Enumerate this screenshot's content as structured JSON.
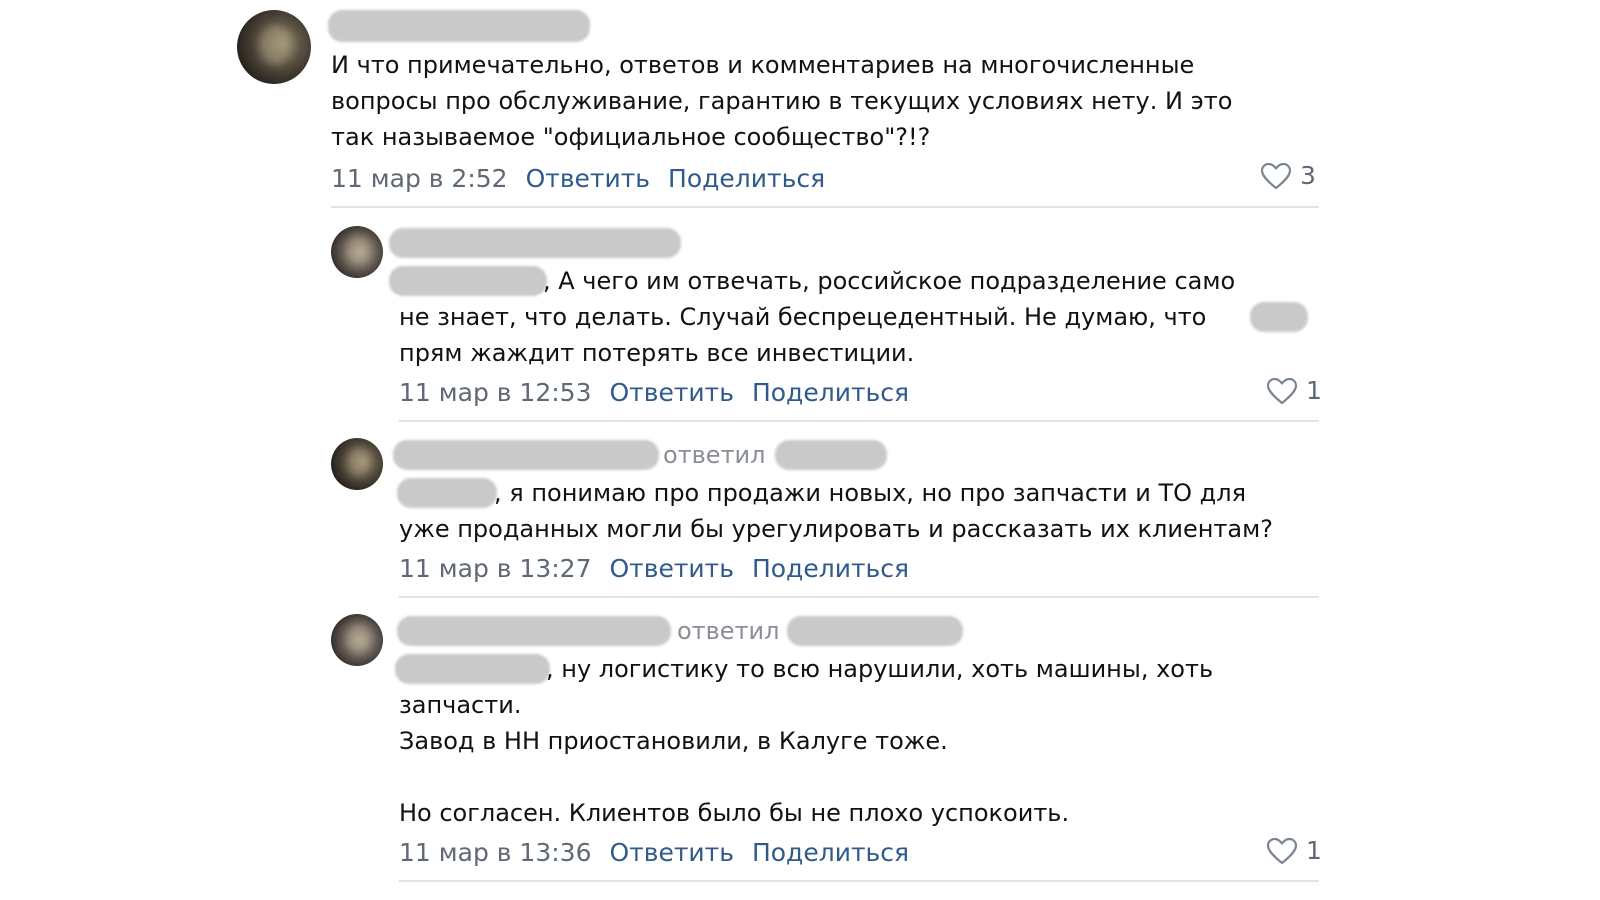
{
  "comments": [
    {
      "text_lines": [
        "И что примечательно, ответов и комментариев на многочисленные",
        "вопросы про обслуживание, гарантию в текущих условиях нету. И это",
        "так называемое \"официальное сообщество\"?!?"
      ],
      "time": "11 мар в 2:52",
      "reply_label": "Ответить",
      "share_label": "Поделиться",
      "likes": "3"
    },
    {
      "text_lines": [
        ", А чего им отвечать, российское подразделение само",
        "не знает, что делать. Случай беспрецедентный. Не думаю, что",
        "прям жаждит потерять все инвестиции."
      ],
      "time": "11 мар в 12:53",
      "reply_label": "Ответить",
      "share_label": "Поделиться",
      "likes": "1"
    },
    {
      "replied_label": "ответил",
      "text_lines": [
        ", я понимаю про продажи новых, но про запчасти и ТО для",
        "уже проданных могли бы урегулировать и рассказать их клиентам?"
      ],
      "time": "11 мар в 13:27",
      "reply_label": "Ответить",
      "share_label": "Поделиться"
    },
    {
      "replied_label": "ответил",
      "text_lines": [
        ", ну логистику то всю нарушили, хоть машины, хоть",
        "запчасти.",
        "Завод в НН приостановили, в Калуге тоже.",
        "",
        "Но согласен. Клиентов было бы не плохо успокоить."
      ],
      "time": "11 мар в 13:36",
      "reply_label": "Ответить",
      "share_label": "Поделиться",
      "likes": "1"
    }
  ]
}
